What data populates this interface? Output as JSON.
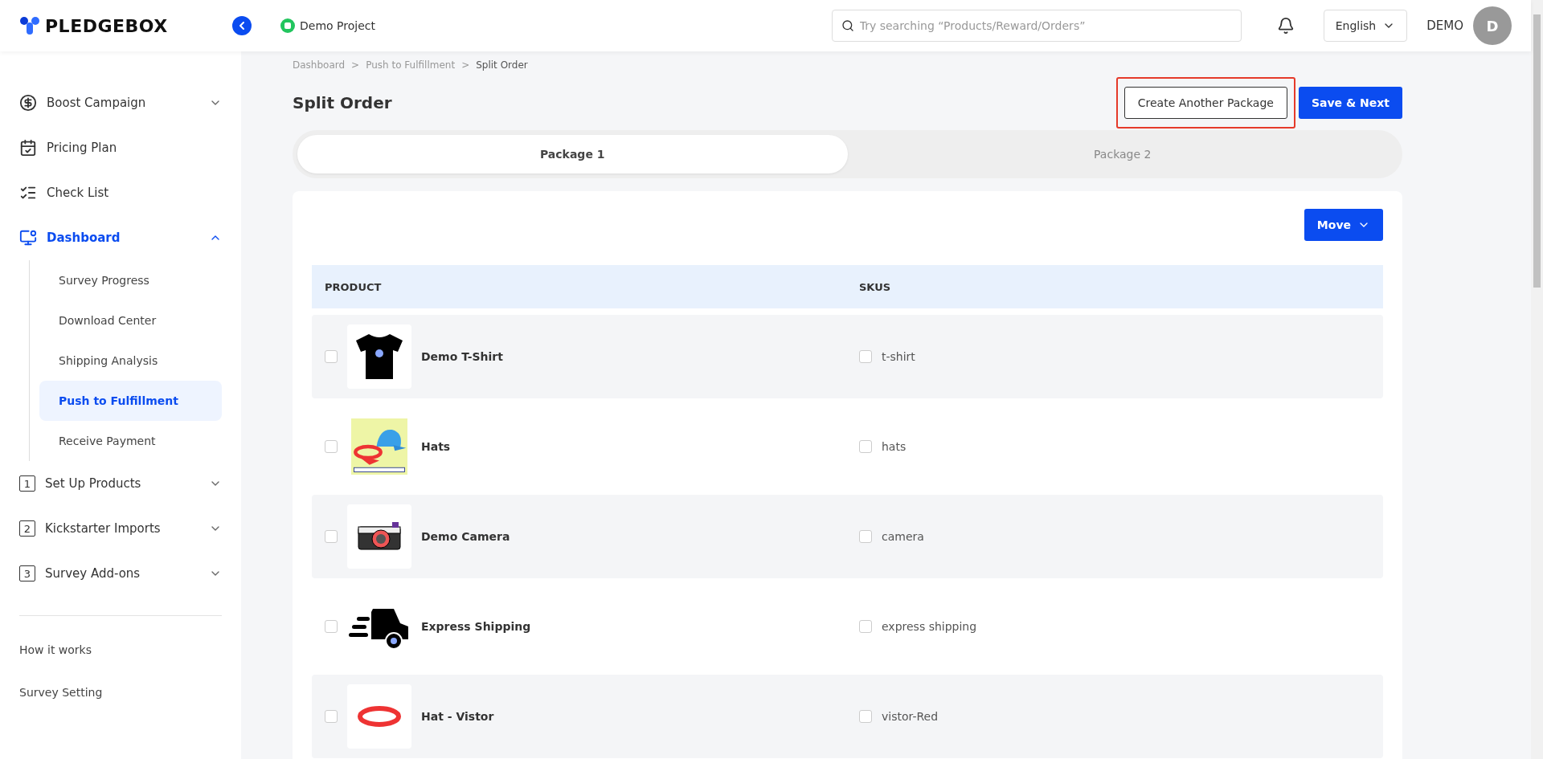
{
  "header": {
    "logo": "PLEDGEBOX",
    "project": "Demo Project",
    "search": {
      "placeholder": "Try searching “Products/Reward/Orders”"
    },
    "language": "English",
    "user": "DEMO",
    "avatar": "D"
  },
  "sidebar": {
    "items": [
      {
        "label": "Boost Campaign",
        "kind": "dollar",
        "expanded": false,
        "selected": false
      },
      {
        "label": "Pricing Plan",
        "kind": "calendar",
        "selected": false
      },
      {
        "label": "Check List",
        "kind": "checklist",
        "selected": false
      },
      {
        "label": "Dashboard",
        "kind": "dashboard",
        "expanded": true,
        "selected": true,
        "children": [
          {
            "label": "Survey Progress",
            "selected": false
          },
          {
            "label": "Download Center",
            "selected": false
          },
          {
            "label": "Shipping Analysis",
            "selected": false
          },
          {
            "label": "Push to Fulfillment",
            "selected": true
          },
          {
            "label": "Receive Payment",
            "selected": false
          }
        ]
      },
      {
        "label": "Set Up Products",
        "kind": "number",
        "badge": "1",
        "expanded": false,
        "selected": false
      },
      {
        "label": "Kickstarter Imports",
        "kind": "number",
        "badge": "2",
        "expanded": false,
        "selected": false
      },
      {
        "label": "Survey Add-ons",
        "kind": "number",
        "badge": "3",
        "expanded": false,
        "selected": false
      }
    ],
    "links": [
      "How it works",
      "Survey Setting"
    ]
  },
  "breadcrumb": [
    "Dashboard",
    "Push to Fulfillment",
    "Split Order"
  ],
  "breadcrumb_separator": ">",
  "title": "Split Order",
  "buttons": {
    "create_package": "Create Another Package",
    "save": "Save & Next",
    "move": "Move"
  },
  "tabs": [
    {
      "label": "Package 1",
      "selected": true
    },
    {
      "label": "Package 2",
      "selected": false
    }
  ],
  "table": {
    "columns": [
      "PRODUCT",
      "SKUS"
    ],
    "rows": [
      {
        "product": "Demo T-Shirt",
        "kind": "tshirt",
        "sku": "t-shirt",
        "checked": false,
        "sku_checked": false
      },
      {
        "product": "Hats",
        "kind": "hats",
        "sku": "hats",
        "checked": false,
        "sku_checked": false
      },
      {
        "product": "Demo Camera",
        "kind": "camera",
        "sku": "camera",
        "checked": false,
        "sku_checked": false
      },
      {
        "product": "Express Shipping",
        "kind": "truck",
        "sku": "express shipping",
        "checked": false,
        "sku_checked": false
      },
      {
        "product": "Hat - Vistor",
        "kind": "visor",
        "sku": "vistor-Red",
        "checked": false,
        "sku_checked": false
      }
    ]
  }
}
